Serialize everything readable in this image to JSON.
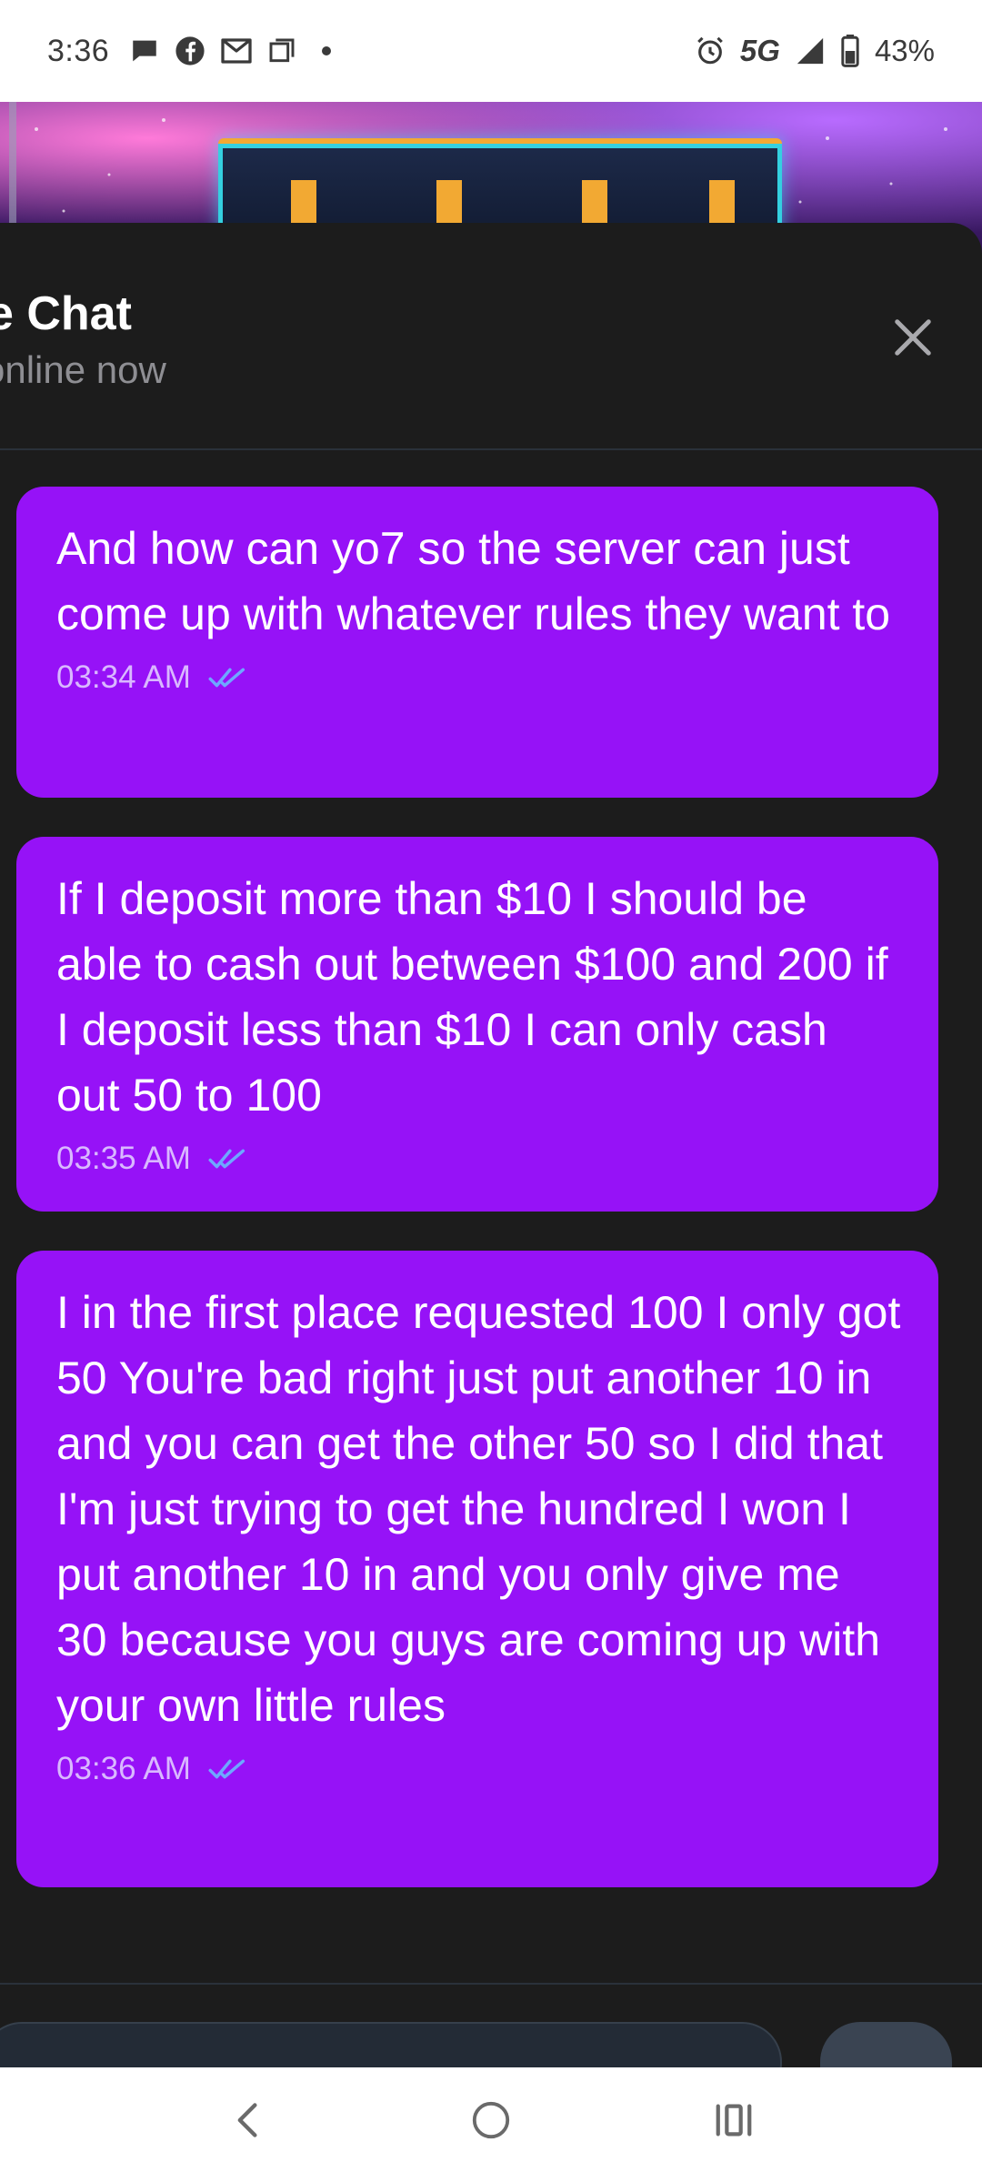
{
  "status_bar": {
    "time": "3:36",
    "network": "5G",
    "battery": "43%",
    "icons": [
      "chat-bubble-icon",
      "facebook-icon",
      "gmail-icon",
      "square-icon",
      "dot-icon",
      "alarm-icon",
      "signal-icon",
      "battery-icon"
    ]
  },
  "chat": {
    "title": "e Chat",
    "status": "online now",
    "close_icon": "close-icon"
  },
  "messages": [
    {
      "text": "And how can yo7 so the server can just come up with whatever rules they want to",
      "time": "03:34 AM",
      "read": true
    },
    {
      "text": "If I deposit more than $10 I should be able to cash out between $100 and 200 if I deposit less than $10 I can only cash out 50 to 100",
      "time": "03:35 AM",
      "read": true
    },
    {
      "text": "I in the first place requested 100 I only got 50 You're bad right just put another 10 in and you can get the other 50 so I did that I'm just trying to get the hundred I won I put another 10 in and you only give me 30 because you guys are coming up with your own little rules",
      "time": "03:36 AM",
      "read": true
    }
  ],
  "colors": {
    "bubble": "#9612f7",
    "sheet_bg": "#1c1c1c",
    "read_check": "#6ea8ff"
  },
  "nav": {
    "back_icon": "back-chevron-icon",
    "home_icon": "home-circle-icon",
    "recents_icon": "recents-icon"
  }
}
